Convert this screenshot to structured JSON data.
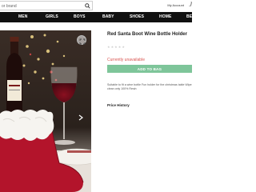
{
  "search": {
    "placeholder": "or brand",
    "value": ""
  },
  "header": {
    "account_label": "My Account",
    "logo": "J"
  },
  "nav": {
    "items": [
      {
        "label": "MEN"
      },
      {
        "label": "GIRLS"
      },
      {
        "label": "BOYS"
      },
      {
        "label": "BABY"
      },
      {
        "label": "SHOES"
      },
      {
        "label": "HOME"
      },
      {
        "label": "BE"
      }
    ]
  },
  "product": {
    "title": "Red Santa Boot Wine Bottle Holder",
    "rating_stars": "★★★★★",
    "availability": "Currently unavailable",
    "add_to_bag_label": "ADD TO BAG",
    "description": "Suitable to fit a wine bottle Fun holder for the christmas table Wipe clean only 100% Resin",
    "price_history_label": "Price History"
  },
  "colors": {
    "nav_bg": "#111111",
    "add_bag": "#7ec59a",
    "unavailable": "#d9534f",
    "boot_red": "#b3142b"
  },
  "icons": {
    "search": "search-icon",
    "expand": "expand-icon",
    "next": "chevron-right-icon"
  }
}
